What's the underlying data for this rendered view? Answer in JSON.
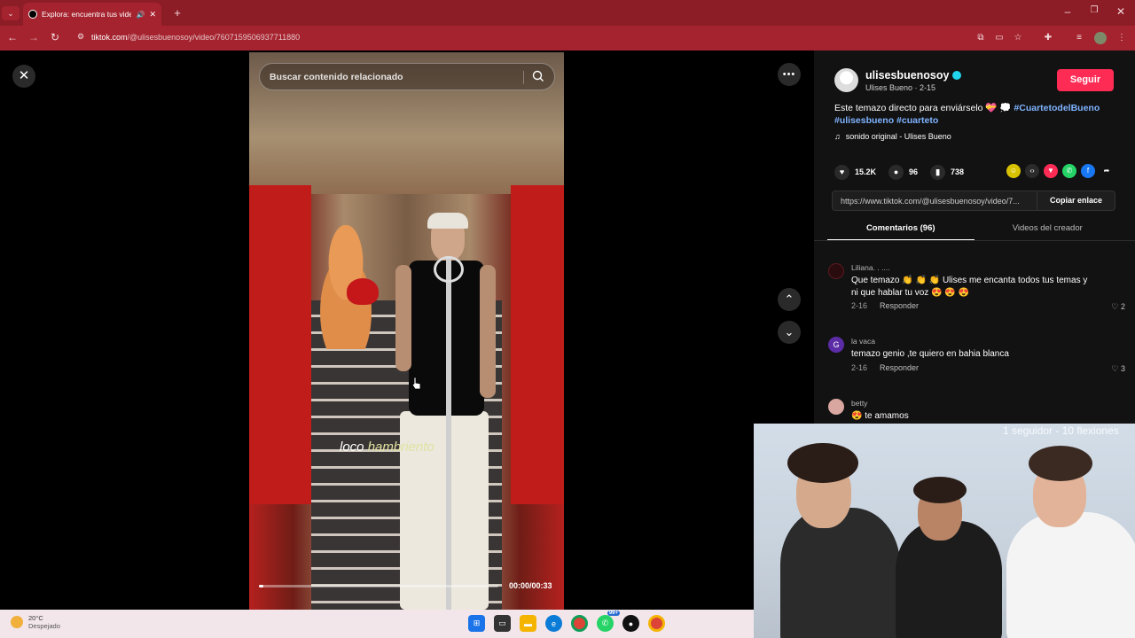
{
  "browser": {
    "tab_title": "Explora: encuentra tus vide",
    "url_domain": "tiktok.com",
    "url_path": "/@ulisesbuenosoy/video/7607159506937711880",
    "icons": [
      "chevron-down-icon",
      "close-icon",
      "plus-icon",
      "back-icon",
      "forward-icon",
      "reload-icon",
      "site-info-icon",
      "translate-icon",
      "cast-icon",
      "star-icon",
      "extensions-icon",
      "reading-list-icon",
      "profile-icon",
      "more-icon",
      "minimize-icon",
      "maximize-icon",
      "window-close-icon"
    ]
  },
  "video": {
    "search_placeholder": "Buscar contenido relacionado",
    "caption_plain": "loco ",
    "caption_highlight": "hambriento",
    "time": "00:00/00:33",
    "progress": 0.02
  },
  "post": {
    "username": "ulisesbuenosoy",
    "subname": "Ulises Bueno · 2-15",
    "follow_label": "Seguir",
    "desc_text": "Este temazo directo para enviárselo 💝 💭 ",
    "desc_tag1": "#CuartetodelBueno",
    "desc_tag2": "#ulisesbueno",
    "desc_tag3": "#cuarteto",
    "sound": "sonido original - Ulises Bueno",
    "likes": "15.2K",
    "comments": "96",
    "saves": "738",
    "link": "https://www.tiktok.com/@ulisesbuenosoy/video/7...",
    "copy_label": "Copiar enlace"
  },
  "tabs": {
    "comments": "Comentarios (96)",
    "creator": "Videos del creador"
  },
  "comments": [
    {
      "name": "Liliana. . ....",
      "text": "Que temazo 👏 👏 👏 Ulises me encanta todos tus temas y ni que hablar tu voz 😍 😍 😍",
      "date": "2-16",
      "reply": "Responder",
      "likes": "2"
    },
    {
      "name": "la vaca",
      "text": "temazo genio ,te quiero en bahia blanca",
      "date": "2-16",
      "reply": "Responder",
      "likes": "3",
      "initial": "G"
    },
    {
      "name": "betty",
      "text": "😍 te amamos"
    }
  ],
  "overlay": {
    "cam_text": "1 seguidor - 10 flexiones"
  },
  "taskbar": {
    "temp": "20°C",
    "weather": "Despejado",
    "badge": "99+"
  },
  "colors": {
    "tab_bar": "#8c1c26",
    "follow": "#fe2c55",
    "verified": "#20d5ec",
    "hashtag": "#7fb3ff"
  }
}
